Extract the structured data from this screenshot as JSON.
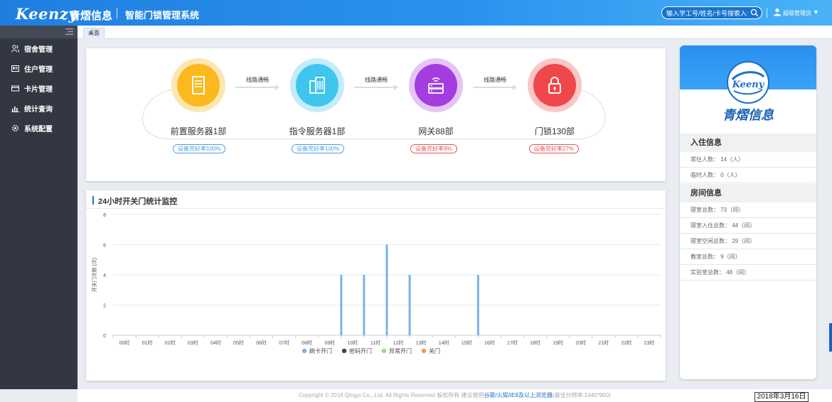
{
  "header": {
    "logo_text": "Keenzy",
    "logo_cn": "青熠信息",
    "app_title": "智能门锁管理系统",
    "search_placeholder": "输入学工号/姓名/卡号搜索入住信息",
    "user_name": "超级管理员",
    "caret": "▼"
  },
  "sidebar": {
    "items": [
      {
        "label": "宿舍管理",
        "icon": "users-icon"
      },
      {
        "label": "住户管理",
        "icon": "id-card-icon"
      },
      {
        "label": "卡片管理",
        "icon": "card-icon"
      },
      {
        "label": "统计查询",
        "icon": "bar-chart-icon"
      },
      {
        "label": "系统配置",
        "icon": "gear-icon"
      }
    ]
  },
  "tabs": [
    {
      "label": "桌面"
    }
  ],
  "flow": {
    "nodes": [
      {
        "label": "前置服务器1部",
        "badge": "设备完好率100%",
        "color": "#fbb91f",
        "halo": "#fde7b0",
        "badge_color": "#4a9fe0",
        "icon": "server-icon"
      },
      {
        "label": "指令服务器1部",
        "badge": "设备完好率100%",
        "color": "#3fc5ee",
        "halo": "#c2ecf9",
        "badge_color": "#4a9fe0",
        "icon": "building-icon"
      },
      {
        "label": "网关88部",
        "badge": "设备完好率9%",
        "color": "#a33de0",
        "halo": "#e4c5f5",
        "badge_color": "#e25656",
        "icon": "router-icon"
      },
      {
        "label": "门锁130部",
        "badge": "设备完好率27%",
        "color": "#f0474a",
        "halo": "#fbc6c6",
        "badge_color": "#e25656",
        "icon": "lock-icon"
      }
    ],
    "links": [
      {
        "label": "线路通畅"
      },
      {
        "label": "线路通畅"
      },
      {
        "label": "线路通畅"
      }
    ]
  },
  "chart_panel": {
    "title": "24小时开关门统计监控"
  },
  "chart_data": {
    "type": "bar",
    "title": "24小时开关门统计监控",
    "ylabel": "开关门次数 (次)",
    "xlabel": "",
    "ylim": [
      0,
      8
    ],
    "yticks": [
      0,
      2,
      4,
      6,
      8
    ],
    "categories": [
      "00时",
      "01时",
      "02时",
      "03时",
      "04时",
      "05时",
      "06时",
      "07时",
      "08时",
      "09时",
      "10时",
      "11时",
      "12时",
      "13时",
      "14时",
      "15时",
      "16时",
      "17时",
      "18时",
      "19时",
      "20时",
      "21时",
      "22时",
      "23时"
    ],
    "series": [
      {
        "name": "刷卡开门",
        "color": "#7ab2e6",
        "values": [
          0,
          0,
          0,
          0,
          0,
          0,
          0,
          0,
          0,
          0,
          4,
          4,
          6,
          4,
          0,
          0,
          4,
          0,
          0,
          0,
          0,
          0,
          0,
          0
        ]
      },
      {
        "name": "密码开门",
        "color": "#444444",
        "values": [
          0,
          0,
          0,
          0,
          0,
          0,
          0,
          0,
          0,
          0,
          0,
          0,
          0,
          0,
          0,
          0,
          0,
          0,
          0,
          0,
          0,
          0,
          0,
          0
        ]
      },
      {
        "name": "异常开门",
        "color": "#8ee07e",
        "values": [
          0,
          0,
          0,
          0,
          0,
          0,
          0,
          0,
          0,
          0,
          0,
          0,
          0,
          0,
          0,
          0,
          0,
          0,
          0,
          0,
          0,
          0,
          0,
          0
        ]
      },
      {
        "name": "关门",
        "color": "#f5994c",
        "values": [
          0,
          0,
          0,
          0,
          0,
          0,
          0,
          0,
          0,
          0,
          0,
          0,
          0,
          0,
          0,
          0,
          0,
          0,
          0,
          0,
          0,
          0,
          0,
          0
        ]
      }
    ],
    "grid": true,
    "legend": "bottom-center"
  },
  "info": {
    "brand_text": "Keeny",
    "brand_name": "青熠信息",
    "sections": [
      {
        "title": "入住信息",
        "rows": [
          "常住人数： 14（人）",
          "临时人数： 0（人）"
        ]
      },
      {
        "title": "房间信息",
        "rows": [
          "寝室总数： 73（间）",
          "寝室入住总数： 44（间）",
          "寝室空闲总数： 29（间）",
          "教室总数： 9（间）",
          "实验室总数： 48（间）"
        ]
      }
    ]
  },
  "footer": {
    "prefix": "Copyright © 2018 Qingyi Co., Ltd. All Rights Reserved 板权所有 建议使用",
    "links": "谷歌/火狐/IE8及以上浏览器",
    "suffix": "(最佳分辨率:1440*900)",
    "date": "2018年3月16日"
  }
}
